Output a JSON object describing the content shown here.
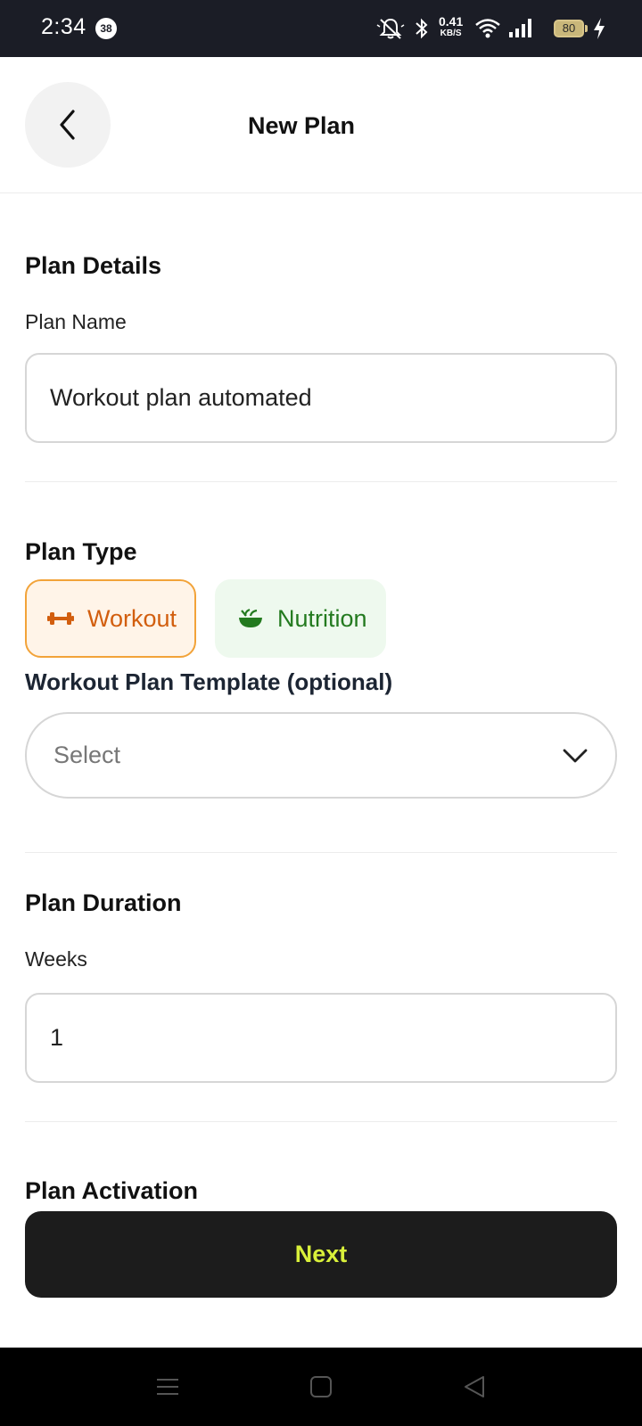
{
  "status_bar": {
    "time": "2:34",
    "notification_count": "38",
    "network_speed": "0.41",
    "network_speed_unit": "KB/S",
    "battery_level": "80"
  },
  "header": {
    "title": "New Plan",
    "back_icon": "chevron-left-icon"
  },
  "plan_details": {
    "section_title": "Plan Details",
    "name_label": "Plan Name",
    "name_value": "Workout plan automated"
  },
  "plan_type": {
    "section_title": "Plan Type",
    "options": [
      {
        "label": "Workout",
        "icon": "dumbbell-icon",
        "selected": true,
        "color": "#d25e0e"
      },
      {
        "label": "Nutrition",
        "icon": "bowl-icon",
        "selected": false,
        "color": "#237a1f"
      }
    ],
    "template_label": "Workout Plan Template (optional)",
    "template_placeholder": "Select"
  },
  "plan_duration": {
    "section_title": "Plan Duration",
    "weeks_label": "Weeks",
    "weeks_value": "1"
  },
  "plan_activation": {
    "section_title": "Plan Activation"
  },
  "footer": {
    "next_label": "Next",
    "next_text_color": "#d9f03a"
  },
  "nav_bar": {
    "icons": [
      "menu-icon",
      "home-square-icon",
      "back-triangle-icon"
    ]
  }
}
